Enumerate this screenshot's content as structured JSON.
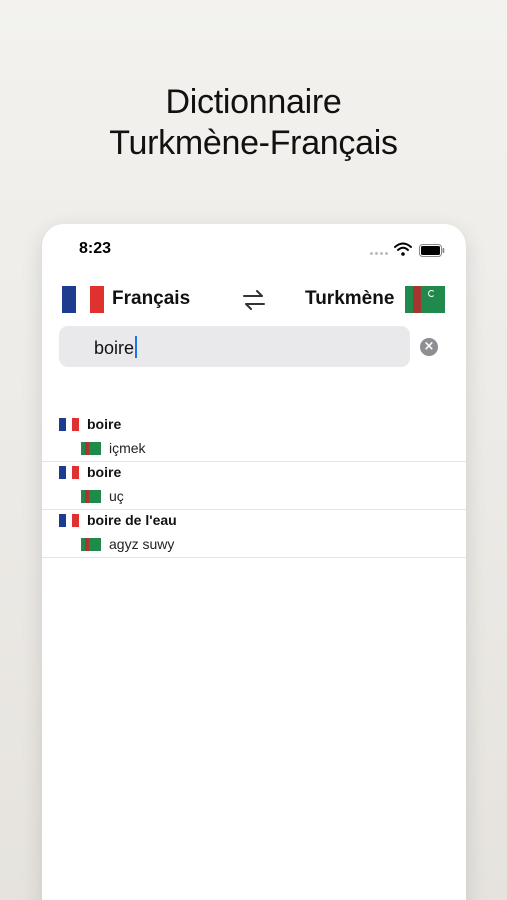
{
  "headline": {
    "line1": "Dictionnaire",
    "line2": "Turkmène-Français"
  },
  "status_bar": {
    "time": "8:23",
    "icons": [
      "signal-icon",
      "wifi-icon",
      "battery-icon"
    ]
  },
  "language_bar": {
    "source_language": "Français",
    "target_language": "Turkmène",
    "source_flag": "flag-france-icon",
    "target_flag": "flag-turkmenistan-icon",
    "swap_icon": "swap-arrows-icon"
  },
  "search": {
    "value": "boire",
    "clear_icon": "clear-circle-icon"
  },
  "results": [
    {
      "source": "boire",
      "target": "içmek"
    },
    {
      "source": "boire",
      "target": "uç"
    },
    {
      "source": "boire de l'eau",
      "target": "agyz suwy"
    }
  ],
  "colors": {
    "france_blue": "#1d3c8f",
    "france_red": "#e0312f",
    "turkmen_green": "#1f8a4c",
    "turkmen_red": "#a6372f",
    "caret_blue": "#1a73e8",
    "search_bg": "#e9e9eb"
  }
}
